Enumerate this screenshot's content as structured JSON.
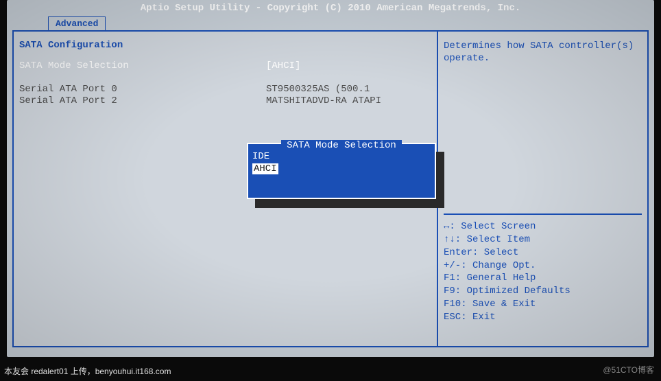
{
  "header": {
    "title": "Aptio Setup Utility - Copyright (C) 2010 American Megatrends, Inc."
  },
  "tab": {
    "label": "Advanced"
  },
  "section": {
    "title": "SATA Configuration"
  },
  "settings": {
    "mode_label": "SATA Mode Selection",
    "mode_value": "[AHCI]"
  },
  "ports": [
    {
      "label": "Serial ATA Port 0",
      "value": "ST9500325AS    (500.1"
    },
    {
      "label": "Serial ATA Port 2",
      "value": "MATSHITADVD-RA ATAPI"
    }
  ],
  "help": {
    "description": "Determines how SATA controller(s) operate.",
    "keys": {
      "screen": "↔: Select Screen",
      "item": "↑↓: Select Item",
      "enter": "Enter: Select",
      "change": "+/-: Change Opt.",
      "f1": "F1: General Help",
      "f9": "F9: Optimized Defaults",
      "f10": "F10: Save & Exit",
      "esc": "ESC: Exit"
    }
  },
  "popup": {
    "title": "SATA Mode Selection",
    "options": {
      "ide": "IDE",
      "ahci": "AHCI"
    },
    "selected": "AHCI"
  },
  "footer": {
    "text": "本友会 redalert01 上传，benyouhui.it168.com",
    "watermark": "@51CTO博客"
  }
}
